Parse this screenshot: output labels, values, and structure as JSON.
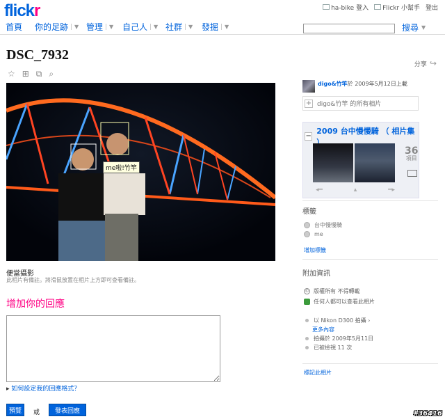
{
  "brand": {
    "logo_a": "flick",
    "logo_b": "r"
  },
  "user_bar": {
    "login": "ha-bike 登入",
    "help": "Flickr 小幫手",
    "logout": "登出"
  },
  "nav": {
    "home": "首頁",
    "you": "你的足跡",
    "organize": "管理",
    "contacts": "自己人",
    "groups": "社群",
    "explore": "發掘",
    "search_button": "搜尋",
    "search_placeholder": ""
  },
  "photo": {
    "title": "DSC_7932",
    "note_text": "me啦!竹竿",
    "caption": "便當攝影",
    "note_hint": "此相片有備註。將滑鼠放置在相片上方即可查看備註。"
  },
  "share": {
    "label": "分享"
  },
  "comments": {
    "heading": "增加你的回應",
    "format_link": "如何設定我的回應格式？",
    "preview_button": "預覽",
    "or_text": "或",
    "post_button": "發表回應"
  },
  "sidebar": {
    "owner_name": "digo&竹竿",
    "uploaded_text": "於 2009年5月12日上載",
    "all_photos": "digo&竹竿 的所有相片",
    "set_title": "2009 台中慢慢騎 （ 相片集 ）",
    "set_count": "36",
    "set_count_unit": "項目",
    "tags_title": "標籤",
    "tags": [
      "台中慢慢騎",
      "me"
    ],
    "add_tag": "增加標籤",
    "info_title": "附加資訊",
    "license": "版權所有 不得轉載",
    "visibility": "任何人都可以查看此相片",
    "camera": "以 Nikon D300 拍攝 ›",
    "more": "更多內容",
    "taken_on": "拍攝於 2009年5月11日",
    "views": "已被檢視 11 次",
    "flag": "標記此相片"
  },
  "watermark": "#36416",
  "colors": {
    "link": "#0063dc",
    "accent": "#ff0084",
    "bridge": "#ff6a1f"
  }
}
